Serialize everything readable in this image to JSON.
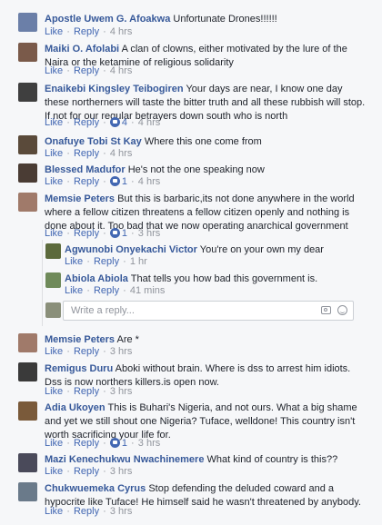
{
  "reaction_icon": "like-reaction-icon",
  "comments": [
    {
      "name": "Apostle Uwem G. Afoakwa",
      "text": "Unfortunate Drones!!!!!!",
      "like": "Like",
      "reply": "Reply",
      "time": "4 hrs",
      "avatar_color": "#6b7fa8"
    },
    {
      "name": "Maiki O. Afolabi",
      "text": "A clan of clowns, either motivated by the lure of the Naira or the ketamine of religious solidarity",
      "like": "Like",
      "reply": "Reply",
      "time": "4 hrs",
      "avatar_color": "#7a5a4a"
    },
    {
      "name": "Enaikebi Kingsley Teibogiren",
      "text": "Your days are near, I know one day these northerners will taste the bitter truth and all these rubbish will stop. If not for our regular betrayers down south who is north",
      "like": "Like",
      "reply": "Reply",
      "reactions": "4",
      "time": "4 hrs",
      "avatar_color": "#3f3f3f"
    },
    {
      "name": "Onafuye Tobi St Kay",
      "text": "Where this one come from",
      "like": "Like",
      "reply": "Reply",
      "time": "4 hrs",
      "avatar_color": "#5a4a3a"
    },
    {
      "name": "Blessed Madufor",
      "text": "He's not the one speaking now",
      "like": "Like",
      "reply": "Reply",
      "reactions": "1",
      "time": "4 hrs",
      "avatar_color": "#4a3c34"
    },
    {
      "name": "Memsie Peters",
      "text": "But this is barbaric,its not done anywhere in the world where a fellow citizen threatens a fellow citizen openly and nothing is done about it. Too bad that we now operating anarchical government",
      "like": "Like",
      "reply": "Reply",
      "reactions": "1",
      "time": "3 hrs",
      "avatar_color": "#a07a6a"
    }
  ],
  "replies": [
    {
      "name": "Agwunobi Onyekachi Victor",
      "text": "You're on your own my dear",
      "like": "Like",
      "reply": "Reply",
      "time": "1 hr",
      "avatar_color": "#5c6a3c"
    },
    {
      "name": "Abiola Abiola",
      "text": "That tells you how bad this government is.",
      "like": "Like",
      "reply": "Reply",
      "time": "41 mins",
      "avatar_color": "#6f8a5a"
    }
  ],
  "reply_box": {
    "placeholder": "Write a reply...",
    "avatar_color": "#8a8f7a"
  },
  "comments2": [
    {
      "name": "Memsie Peters",
      "text": "Are *",
      "like": "Like",
      "reply": "Reply",
      "time": "3 hrs",
      "avatar_color": "#a07a6a"
    },
    {
      "name": "Remigus Duru",
      "text": "Aboki without brain. Where is dss to arrest him idiots. Dss is now northers killers.is open now.",
      "like": "Like",
      "reply": "Reply",
      "time": "3 hrs",
      "avatar_color": "#3a3a3a"
    },
    {
      "name": "Adia Ukoyen",
      "text": "This is Buhari's Nigeria, and not ours. What a big shame and yet we still shout one Nigeria? Tuface, welldone! This country isn't worth sacrificing your life for.",
      "like": "Like",
      "reply": "Reply",
      "reactions": "1",
      "time": "3 hrs",
      "avatar_color": "#7a5a3a"
    },
    {
      "name": "Mazi Kenechukwu Nwachinemere",
      "text": "What kind of country is this??",
      "like": "Like",
      "reply": "Reply",
      "time": "3 hrs",
      "avatar_color": "#4a4a5a"
    },
    {
      "name": "Chukwuemeka Cyrus",
      "text": "Stop defending the deluded coward and a hypocrite like Tuface! He himself said he wasn't threatened by anybody.",
      "like": "Like",
      "reply": "Reply",
      "time": "3 hrs",
      "avatar_color": "#6a7a8a"
    }
  ]
}
